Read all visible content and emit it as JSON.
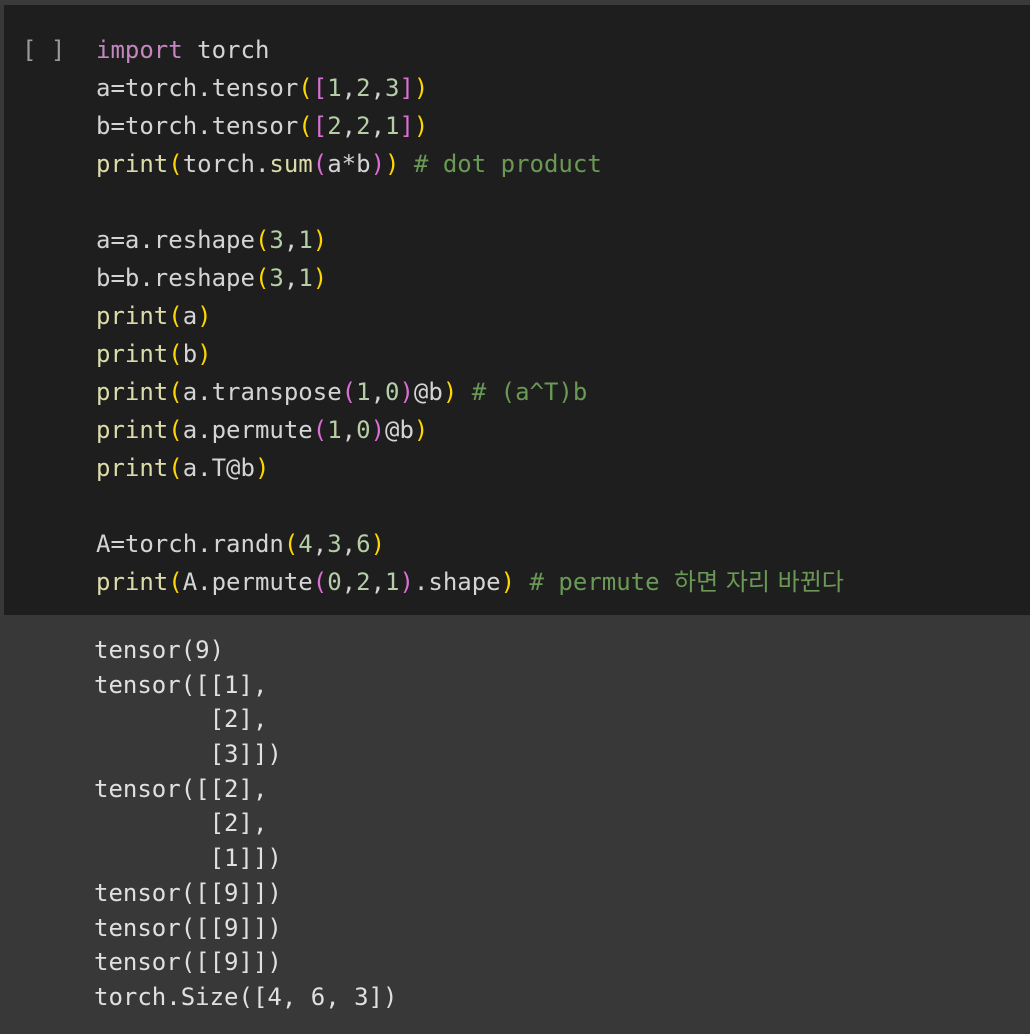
{
  "cell": {
    "run_indicator": "[ ]"
  },
  "code": {
    "lines": [
      [
        {
          "t": "import",
          "c": "kw"
        },
        {
          "t": " torch",
          "c": ""
        }
      ],
      [
        {
          "t": "a=torch.tensor",
          "c": ""
        },
        {
          "t": "(",
          "c": "p1"
        },
        {
          "t": "[",
          "c": "p2"
        },
        {
          "t": "1",
          "c": "num"
        },
        {
          "t": ",",
          "c": ""
        },
        {
          "t": "2",
          "c": "num"
        },
        {
          "t": ",",
          "c": ""
        },
        {
          "t": "3",
          "c": "num"
        },
        {
          "t": "]",
          "c": "p2"
        },
        {
          "t": ")",
          "c": "p1"
        }
      ],
      [
        {
          "t": "b=torch.tensor",
          "c": ""
        },
        {
          "t": "(",
          "c": "p1"
        },
        {
          "t": "[",
          "c": "p2"
        },
        {
          "t": "2",
          "c": "num"
        },
        {
          "t": ",",
          "c": ""
        },
        {
          "t": "2",
          "c": "num"
        },
        {
          "t": ",",
          "c": ""
        },
        {
          "t": "1",
          "c": "num"
        },
        {
          "t": "]",
          "c": "p2"
        },
        {
          "t": ")",
          "c": "p1"
        }
      ],
      [
        {
          "t": "print",
          "c": "fn"
        },
        {
          "t": "(",
          "c": "p1"
        },
        {
          "t": "torch.",
          "c": ""
        },
        {
          "t": "sum",
          "c": "fn"
        },
        {
          "t": "(",
          "c": "p2"
        },
        {
          "t": "a*b",
          "c": ""
        },
        {
          "t": ")",
          "c": "p2"
        },
        {
          "t": ")",
          "c": "p1"
        },
        {
          "t": " # dot product",
          "c": "cmt"
        }
      ],
      [],
      [
        {
          "t": "a=a.reshape",
          "c": ""
        },
        {
          "t": "(",
          "c": "p1"
        },
        {
          "t": "3",
          "c": "num"
        },
        {
          "t": ",",
          "c": ""
        },
        {
          "t": "1",
          "c": "num"
        },
        {
          "t": ")",
          "c": "p1"
        }
      ],
      [
        {
          "t": "b=b.reshape",
          "c": ""
        },
        {
          "t": "(",
          "c": "p1"
        },
        {
          "t": "3",
          "c": "num"
        },
        {
          "t": ",",
          "c": ""
        },
        {
          "t": "1",
          "c": "num"
        },
        {
          "t": ")",
          "c": "p1"
        }
      ],
      [
        {
          "t": "print",
          "c": "fn"
        },
        {
          "t": "(",
          "c": "p1"
        },
        {
          "t": "a",
          "c": ""
        },
        {
          "t": ")",
          "c": "p1"
        }
      ],
      [
        {
          "t": "print",
          "c": "fn"
        },
        {
          "t": "(",
          "c": "p1"
        },
        {
          "t": "b",
          "c": ""
        },
        {
          "t": ")",
          "c": "p1"
        }
      ],
      [
        {
          "t": "print",
          "c": "fn"
        },
        {
          "t": "(",
          "c": "p1"
        },
        {
          "t": "a.transpose",
          "c": ""
        },
        {
          "t": "(",
          "c": "p2"
        },
        {
          "t": "1",
          "c": "num"
        },
        {
          "t": ",",
          "c": ""
        },
        {
          "t": "0",
          "c": "num"
        },
        {
          "t": ")",
          "c": "p2"
        },
        {
          "t": "@b",
          "c": ""
        },
        {
          "t": ")",
          "c": "p1"
        },
        {
          "t": " # (a^T)b",
          "c": "cmt"
        }
      ],
      [
        {
          "t": "print",
          "c": "fn"
        },
        {
          "t": "(",
          "c": "p1"
        },
        {
          "t": "a.permute",
          "c": ""
        },
        {
          "t": "(",
          "c": "p2"
        },
        {
          "t": "1",
          "c": "num"
        },
        {
          "t": ",",
          "c": ""
        },
        {
          "t": "0",
          "c": "num"
        },
        {
          "t": ")",
          "c": "p2"
        },
        {
          "t": "@b",
          "c": ""
        },
        {
          "t": ")",
          "c": "p1"
        }
      ],
      [
        {
          "t": "print",
          "c": "fn"
        },
        {
          "t": "(",
          "c": "p1"
        },
        {
          "t": "a.T@b",
          "c": ""
        },
        {
          "t": ")",
          "c": "p1"
        }
      ],
      [],
      [
        {
          "t": "A=torch.randn",
          "c": ""
        },
        {
          "t": "(",
          "c": "p1"
        },
        {
          "t": "4",
          "c": "num"
        },
        {
          "t": ",",
          "c": ""
        },
        {
          "t": "3",
          "c": "num"
        },
        {
          "t": ",",
          "c": ""
        },
        {
          "t": "6",
          "c": "num"
        },
        {
          "t": ")",
          "c": "p1"
        }
      ],
      [
        {
          "t": "print",
          "c": "fn"
        },
        {
          "t": "(",
          "c": "p1"
        },
        {
          "t": "A.permute",
          "c": ""
        },
        {
          "t": "(",
          "c": "p2"
        },
        {
          "t": "0",
          "c": "num"
        },
        {
          "t": ",",
          "c": ""
        },
        {
          "t": "2",
          "c": "num"
        },
        {
          "t": ",",
          "c": ""
        },
        {
          "t": "1",
          "c": "num"
        },
        {
          "t": ")",
          "c": "p2"
        },
        {
          "t": ".shape",
          "c": ""
        },
        {
          "t": ")",
          "c": "p1"
        },
        {
          "t": " # permute ",
          "c": "cmt"
        },
        {
          "t": "하면 자리 바뀐다",
          "c": "cmt cmt-kr"
        }
      ]
    ]
  },
  "output": {
    "lines": [
      "tensor(9)",
      "tensor([[1],",
      "        [2],",
      "        [3]])",
      "tensor([[2],",
      "        [2],",
      "        [1]])",
      "tensor([[9]])",
      "tensor([[9]])",
      "tensor([[9]])",
      "torch.Size([4, 6, 3])"
    ]
  }
}
